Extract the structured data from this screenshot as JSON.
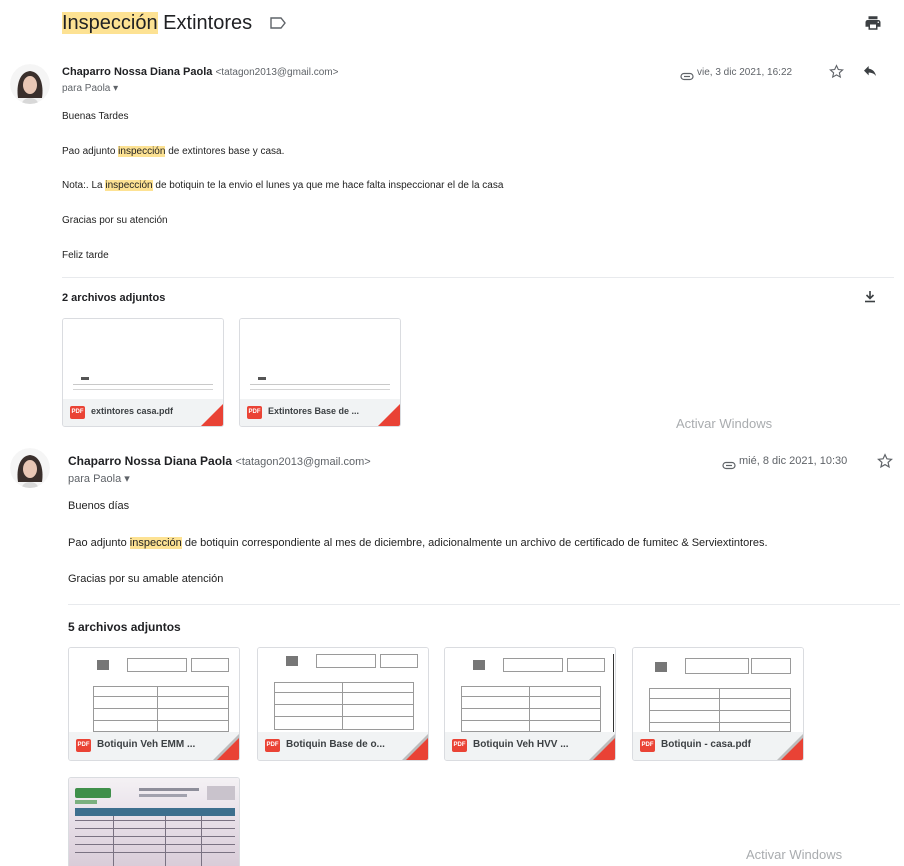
{
  "subject": {
    "highlight": "Inspección",
    "rest": " Extintores"
  },
  "icons": {
    "label": "label-icon",
    "print": "print-icon",
    "star": "star-icon",
    "reply": "reply-icon",
    "attachment": "paperclip-icon",
    "download": "download-icon",
    "dropdown": "chevron-down-icon"
  },
  "messages": [
    {
      "sender_name": "Chaparro Nossa Diana Paola",
      "sender_email": "<tatagon2013@gmail.com>",
      "to": "para Paola ▾",
      "date": "vie, 3 dic 2021, 16:22",
      "body": {
        "greeting": "Buenas Tardes",
        "line1_pre": "Pao adjunto ",
        "line1_hl": "inspección",
        "line1_post": " de extintores base y casa.",
        "line2_pre": "Nota:. La ",
        "line2_hl": "inspección",
        "line2_post": " de botiquin te la envio el lunes ya que me hace falta inspeccionar el de la casa",
        "thanks": "Gracias por su atención",
        "closing": "Feliz tarde"
      },
      "attachments_title": "2 archivos adjuntos",
      "attachments": [
        {
          "badge": "PDF",
          "name": "extintores casa.pdf"
        },
        {
          "badge": "PDF",
          "name": "Extintores Base de ..."
        }
      ]
    },
    {
      "sender_name": "Chaparro Nossa Diana Paola",
      "sender_email": "<tatagon2013@gmail.com>",
      "to": "para Paola ▾",
      "date": "mié, 8 dic 2021, 10:30",
      "body": {
        "greeting": "Buenos días",
        "line1_pre": "Pao adjunto ",
        "line1_hl": "inspección",
        "line1_post": " de botiquin correspondiente al mes de diciembre, adicionalmente un archivo de certificado de fumitec & Serviextintores.",
        "thanks": "Gracias por su amable atención"
      },
      "attachments_title": "5 archivos adjuntos",
      "attachments": [
        {
          "badge": "PDF",
          "name": "Botiquin Veh EMM ..."
        },
        {
          "badge": "PDF",
          "name": "Botiquin Base de o..."
        },
        {
          "badge": "PDF",
          "name": "Botiquin Veh HVV ..."
        },
        {
          "badge": "PDF",
          "name": "Botiquin - casa.pdf"
        }
      ]
    }
  ],
  "watermarks": [
    "Activar Windows",
    "Activar Windows"
  ],
  "colors": {
    "highlight": "#fde293",
    "pdf_red": "#ea4335",
    "muted": "#5f6368"
  }
}
